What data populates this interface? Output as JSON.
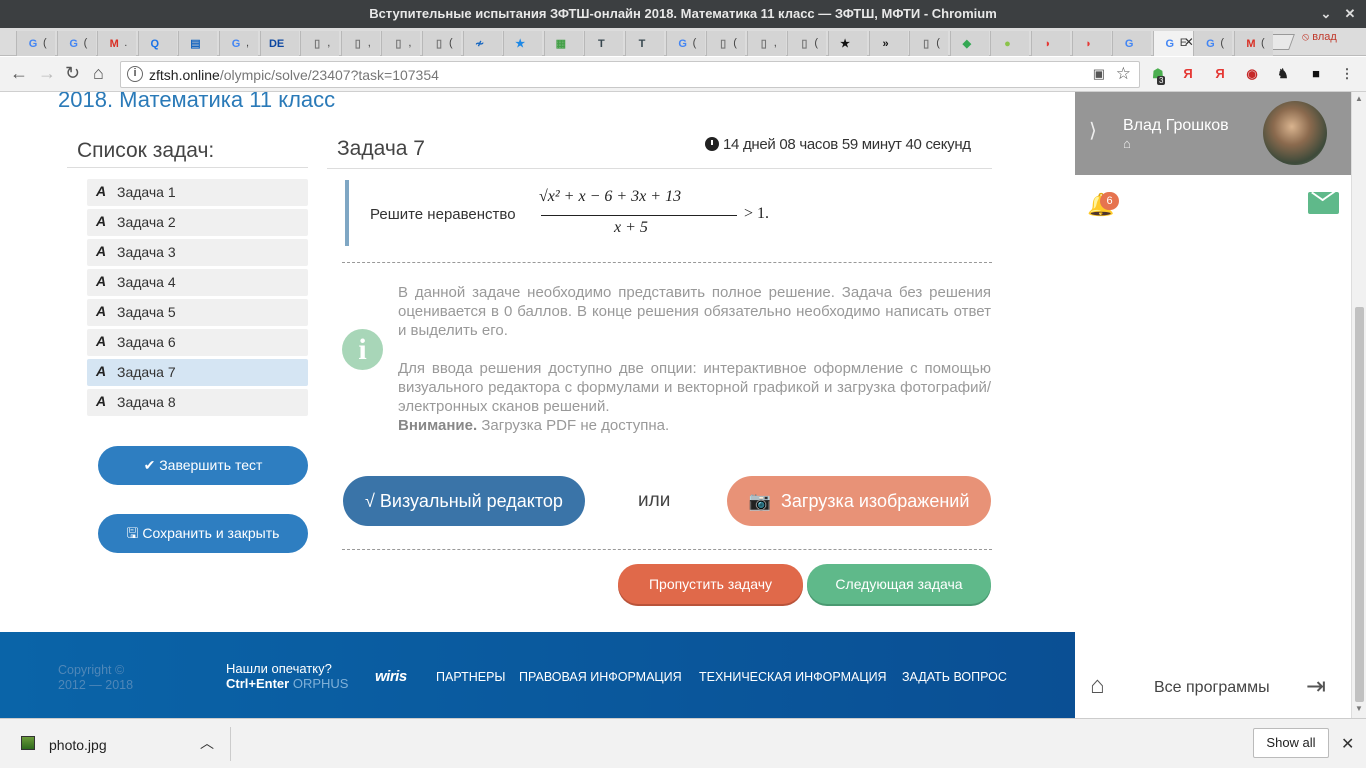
{
  "window": {
    "title": "Вступительные испытания ЗФТШ-онлайн 2018. Математика 11 класс — ЗФТШ, МФТИ - Chromium"
  },
  "tabs": [
    {
      "icon": "G",
      "color": "#4285f4",
      "text": "("
    },
    {
      "icon": "G",
      "color": "#4285f4",
      "text": "("
    },
    {
      "icon": "M",
      "color": "#d93025",
      "text": "."
    },
    {
      "icon": "Q",
      "color": "#1a73e8",
      "text": ""
    },
    {
      "icon": "▤",
      "color": "#1565c0",
      "text": ""
    },
    {
      "icon": "G",
      "color": "#4285f4",
      "text": ","
    },
    {
      "icon": "DE",
      "color": "#0d47a1",
      "text": ""
    },
    {
      "icon": "▯",
      "color": "#777",
      "text": ","
    },
    {
      "icon": "▯",
      "color": "#777",
      "text": ","
    },
    {
      "icon": "▯",
      "color": "#777",
      "text": ","
    },
    {
      "icon": "▯",
      "color": "#777",
      "text": "("
    },
    {
      "icon": "≁",
      "color": "#1565c0",
      "text": ""
    },
    {
      "icon": "★",
      "color": "#1e88e5",
      "text": ""
    },
    {
      "icon": "▦",
      "color": "#43a047",
      "text": ""
    },
    {
      "icon": "T",
      "color": "#37474f",
      "text": ""
    },
    {
      "icon": "T",
      "color": "#37474f",
      "text": ""
    },
    {
      "icon": "G",
      "color": "#4285f4",
      "text": "("
    },
    {
      "icon": "▯",
      "color": "#777",
      "text": "("
    },
    {
      "icon": "▯",
      "color": "#777",
      "text": ","
    },
    {
      "icon": "▯",
      "color": "#777",
      "text": "("
    },
    {
      "icon": "★",
      "color": "#111",
      "text": ""
    },
    {
      "icon": "»",
      "color": "#111",
      "text": ""
    },
    {
      "icon": "▯",
      "color": "#777",
      "text": "("
    },
    {
      "icon": "◆",
      "color": "#34a853",
      "text": ""
    },
    {
      "icon": "●",
      "color": "#8bc34a",
      "text": ""
    },
    {
      "icon": "◗",
      "color": "#e53935",
      "text": ""
    },
    {
      "icon": "◗",
      "color": "#e53935",
      "text": ""
    },
    {
      "icon": "G",
      "color": "#4285f4",
      "text": ""
    },
    {
      "icon": "G",
      "color": "#4285f4",
      "text": "E"
    },
    {
      "icon": "G",
      "color": "#4285f4",
      "text": "("
    },
    {
      "icon": "M",
      "color": "#d93025",
      "text": "("
    }
  ],
  "active_tab_index": 28,
  "profile_name": "влад",
  "address": {
    "host": "zftsh.online",
    "path": "/olympic/solve/23407?task=107354"
  },
  "extensions": [
    {
      "glyph": "☗",
      "color": "#4caf50",
      "badge": "3"
    },
    {
      "glyph": "Я",
      "color": "#e53935"
    },
    {
      "glyph": "Я",
      "color": "#e53935"
    },
    {
      "glyph": "◉",
      "color": "#c62828"
    },
    {
      "glyph": "♞",
      "color": "#222"
    },
    {
      "glyph": "■",
      "color": "#111"
    },
    {
      "glyph": "⋮",
      "color": "#555"
    }
  ],
  "page": {
    "title": "2018. Математика 11 класс",
    "task_list_heading": "Список задач:",
    "tasks": [
      "Задача 1",
      "Задача 2",
      "Задача 3",
      "Задача 4",
      "Задача 5",
      "Задача 6",
      "Задача 7",
      "Задача 8"
    ],
    "active_task": 6,
    "finish_button": "Завершить тест",
    "save_button": "Сохранить и закрыть",
    "task_heading": "Задача 7",
    "timer": "14 дней 08 часов 59 минут 40 секунд",
    "problem_lead": "Решите неравенство",
    "formula": {
      "numerator": "√x² + x − 6 + 3x + 13",
      "denominator": "x + 5",
      "rhs": "> 1."
    },
    "info_para1": "В данной задаче необходимо представить полное решение. Задача без решения оценивается в 0 баллов. В конце решения обязательно необходимо написать ответ и выделить его.",
    "info_para2": "Для ввода решения доступно две опции: интерактивное оформление с помощью визуального редактора с формулами и векторной графикой и загрузка фотографий/электронных сканов решений.",
    "warning_label": "Внимание.",
    "warning_text": "Загрузка PDF не доступна.",
    "visual_editor_button": "√  Визуальный редактор",
    "or_text": "или",
    "upload_button": "Загрузка изображений",
    "skip_button": "Пропустить задачу",
    "next_button": "Следующая задача"
  },
  "footer": {
    "copyright": "Copyright ©",
    "years": "2012 — 2018",
    "typo_q": "Нашли опечатку?",
    "typo_keys": "Ctrl+Enter",
    "typo_brand": "ORPHUS",
    "wiris": "wiris",
    "links": [
      "ПАРТНЕРЫ",
      "ПРАВОВАЯ ИНФОРМАЦИЯ",
      "ТЕХНИЧЕСКАЯ ИНФОРМАЦИЯ",
      "ЗАДАТЬ ВОПРОС"
    ]
  },
  "sidebar": {
    "user_name": "Влад Грошков",
    "notifications": "6",
    "all_programs": "Все программы"
  },
  "download": {
    "file": "photo.jpg",
    "show_all": "Show all"
  },
  "colors": {
    "accent_blue": "#2e7ec1",
    "orange": "#e0694a",
    "green": "#5fb98a",
    "footer": "#0a5aa0"
  }
}
